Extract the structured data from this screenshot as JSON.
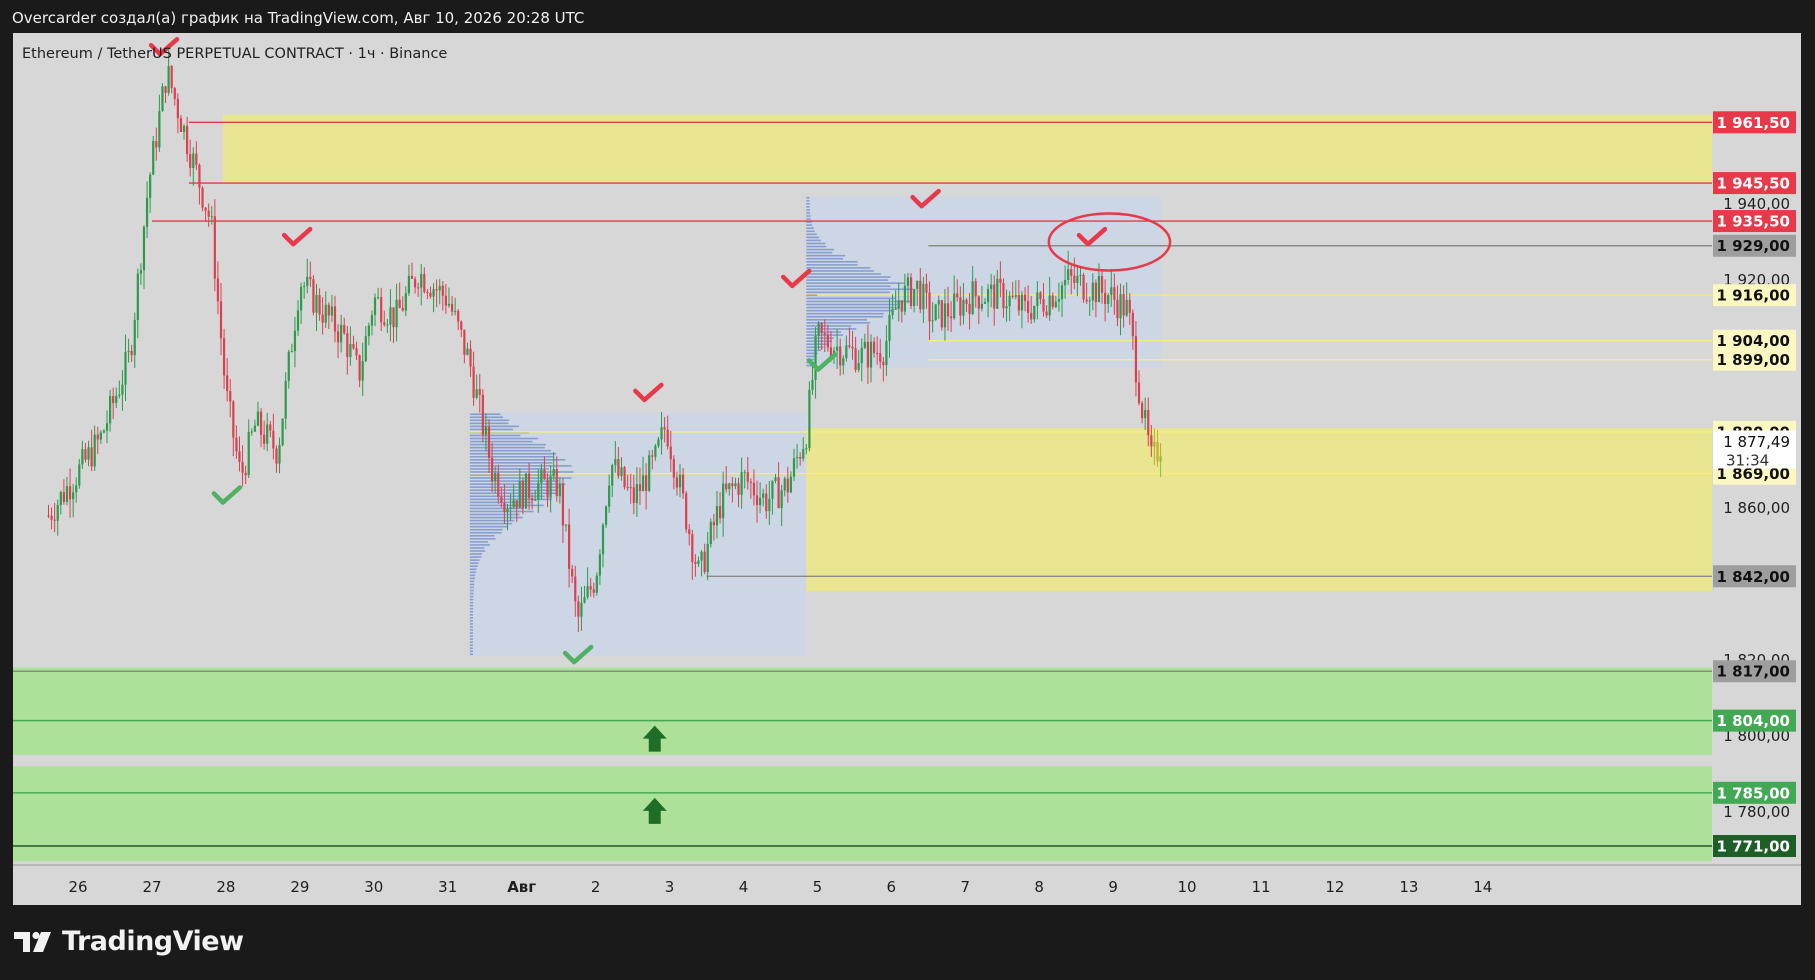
{
  "header": {
    "attribution": "Overcarder создал(а) график на TradingView.com, Авг 10, 2026 20:28 UTC"
  },
  "logo": {
    "text": "TradingView",
    "icon": "tradingview-logo-icon"
  },
  "colors": {
    "background": "#d7d7d7",
    "frame": "#1a1a1a",
    "resistance_zone": "#ebe68a",
    "support_zone": "#a9e294",
    "volume_profile": "#c9d6ea",
    "profile_bars": "#7a93c9",
    "candle_up": "#2e9a4c",
    "candle_down": "#d9414f",
    "mark_red": "#e8394a",
    "mark_green": "#4fb162",
    "arrow_green": "#1e6e28"
  },
  "chart_data": {
    "type": "candlestick",
    "title": "Ethereum / TetherUS PERPETUAL CONTRACT · 1ч · Binance",
    "x_tick_labels": [
      "26",
      "27",
      "28",
      "29",
      "30",
      "31",
      "Авг",
      "2",
      "3",
      "4",
      "5",
      "6",
      "7",
      "8",
      "9",
      "10",
      "11",
      "12",
      "13",
      "14"
    ],
    "y_axis_ticks": [
      "1 940,00",
      "1 920,00",
      "1 880,00",
      "1 860,00",
      "1 820,00",
      "1 800,00",
      "1 780,00"
    ],
    "y_range": [
      1766,
      1985
    ],
    "price_labels": [
      {
        "price": 1961.5,
        "text": "1 961,50",
        "bg": "#e8394a",
        "fg": "#ffffff"
      },
      {
        "price": 1945.5,
        "text": "1 945,50",
        "bg": "#e8394a",
        "fg": "#ffffff"
      },
      {
        "price": 1935.5,
        "text": "1 935,50",
        "bg": "#e8394a",
        "fg": "#ffffff"
      },
      {
        "price": 1929.0,
        "text": "1 929,00",
        "bg": "#9e9e9e",
        "fg": "#111111"
      },
      {
        "price": 1916.0,
        "text": "1 916,00",
        "bg": "#fbf7c2",
        "fg": "#111111"
      },
      {
        "price": 1904.0,
        "text": "1 904,00",
        "bg": "#fbf7c2",
        "fg": "#111111"
      },
      {
        "price": 1899.0,
        "text": "1 899,00",
        "bg": "#fbf7c2",
        "fg": "#111111"
      },
      {
        "price": 1880.0,
        "text": "1 880,00",
        "bg": "#fbf7c2",
        "fg": "#111111"
      },
      {
        "price": 1869.0,
        "text": "1 869,00",
        "bg": "#fbf7c2",
        "fg": "#111111"
      },
      {
        "price": 1842.0,
        "text": "1 842,00",
        "bg": "#9e9e9e",
        "fg": "#111111"
      },
      {
        "price": 1817.0,
        "text": "1 817,00",
        "bg": "#9e9e9e",
        "fg": "#111111"
      },
      {
        "price": 1804.0,
        "text": "1 804,00",
        "bg": "#43a853",
        "fg": "#ffffff"
      },
      {
        "price": 1785.0,
        "text": "1 785,00",
        "bg": "#43a853",
        "fg": "#ffffff"
      },
      {
        "price": 1771.0,
        "text": "1 771,00",
        "bg": "#1e5e27",
        "fg": "#ffffff"
      }
    ],
    "current_price": {
      "price": 1877.49,
      "text": "1 877,49",
      "countdown": "31:34"
    },
    "zones": [
      {
        "kind": "resistance",
        "from": 1945.5,
        "to": 1963.5
      },
      {
        "kind": "demand",
        "from": 1838,
        "to": 1881
      },
      {
        "kind": "support",
        "from": 1795,
        "to": 1818
      },
      {
        "kind": "support",
        "from": 1767,
        "to": 1792
      }
    ],
    "levels": [
      {
        "price": 1961.5,
        "color": "#e8394a"
      },
      {
        "price": 1945.5,
        "color": "#e8394a"
      },
      {
        "price": 1935.5,
        "color": "#e8394a"
      },
      {
        "price": 1929.0,
        "color": "#8a8a8a"
      },
      {
        "price": 1916.0,
        "color": "#f4ee7a"
      },
      {
        "price": 1904.0,
        "color": "#f4ee7a"
      },
      {
        "price": 1899.0,
        "color": "#f4ee7a"
      },
      {
        "price": 1880.0,
        "color": "#f4ee7a"
      },
      {
        "price": 1869.0,
        "color": "#f4ee7a"
      },
      {
        "price": 1842.0,
        "color": "#8a8a8a"
      },
      {
        "price": 1817.0,
        "color": "#8a8a8a"
      },
      {
        "price": 1804.0,
        "color": "#43a853"
      },
      {
        "price": 1785.0,
        "color": "#43a853"
      },
      {
        "price": 1771.0,
        "color": "#1e5e27"
      }
    ],
    "price_path": [
      [
        25.6,
        1858
      ],
      [
        26.3,
        1878
      ],
      [
        26.7,
        1900
      ],
      [
        26.95,
        1945
      ],
      [
        27.2,
        1975
      ],
      [
        27.5,
        1955
      ],
      [
        27.8,
        1935
      ],
      [
        28.0,
        1890
      ],
      [
        28.2,
        1868
      ],
      [
        28.4,
        1882
      ],
      [
        28.7,
        1875
      ],
      [
        29.0,
        1920
      ],
      [
        29.3,
        1912
      ],
      [
        29.6,
        1905
      ],
      [
        29.8,
        1895
      ],
      [
        30.0,
        1915
      ],
      [
        30.3,
        1910
      ],
      [
        30.6,
        1922
      ],
      [
        31.0,
        1915
      ],
      [
        31.3,
        1898
      ],
      [
        31.6,
        1870
      ],
      [
        31.8,
        1862
      ],
      [
        32.2,
        1866
      ],
      [
        32.5,
        1866
      ],
      [
        32.75,
        1830
      ],
      [
        33.0,
        1842
      ],
      [
        33.2,
        1872
      ],
      [
        33.5,
        1862
      ],
      [
        33.8,
        1872
      ],
      [
        33.95,
        1882
      ],
      [
        34.2,
        1860
      ],
      [
        34.4,
        1842
      ],
      [
        34.7,
        1862
      ],
      [
        35.0,
        1868
      ],
      [
        35.3,
        1862
      ],
      [
        35.6,
        1866
      ],
      [
        35.85,
        1880
      ],
      [
        36.0,
        1905
      ],
      [
        36.3,
        1902
      ],
      [
        36.6,
        1900
      ],
      [
        36.9,
        1902
      ],
      [
        37.1,
        1915
      ],
      [
        37.35,
        1918
      ],
      [
        37.55,
        1910
      ],
      [
        37.8,
        1912
      ],
      [
        38.1,
        1916
      ],
      [
        38.5,
        1916
      ],
      [
        38.8,
        1912
      ],
      [
        39.1,
        1915
      ],
      [
        39.4,
        1920
      ],
      [
        39.7,
        1918
      ],
      [
        39.95,
        1916
      ],
      [
        40.2,
        1912
      ],
      [
        40.4,
        1885
      ],
      [
        40.52,
        1872
      ],
      [
        40.6,
        1875
      ],
      [
        40.65,
        1877.49
      ]
    ],
    "volume_profiles": [
      {
        "x_start": 31.3,
        "x_end": 35.85,
        "price_low": 1821,
        "price_high": 1885,
        "poc": 1869
      },
      {
        "x_start": 35.85,
        "x_end": 40.65,
        "price_low": 1897,
        "price_high": 1942,
        "poc": 1916
      }
    ],
    "annotations": {
      "red_checks": [
        [
          27.15,
          1981
        ],
        [
          28.95,
          1931
        ],
        [
          33.7,
          1890
        ],
        [
          35.7,
          1920
        ],
        [
          37.45,
          1941
        ],
        [
          39.7,
          1931
        ]
      ],
      "green_checks": [
        [
          28.0,
          1863
        ],
        [
          32.75,
          1821
        ],
        [
          36.05,
          1898
        ]
      ],
      "arrows_up": [
        [
          33.8,
          1799
        ],
        [
          33.8,
          1780
        ]
      ],
      "ellipse": {
        "cx": 39.95,
        "cy": 1930,
        "rx": 0.82,
        "ry": 7.5
      }
    }
  }
}
